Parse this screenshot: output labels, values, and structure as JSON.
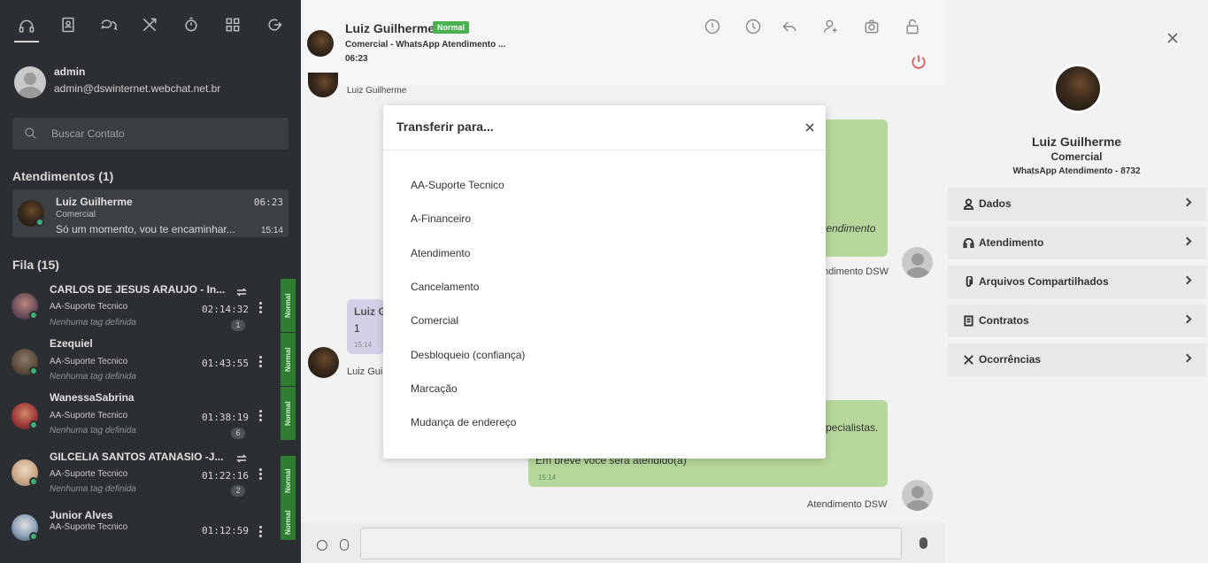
{
  "sidebar": {
    "nav_icons": [
      "headset-icon",
      "contacts-book-icon",
      "chat-bubbles-icon",
      "tools-icon",
      "timer-icon",
      "grid-icon",
      "logout-icon"
    ],
    "profile": {
      "name": "admin",
      "email": "admin@dswinternet.webchat.net.br"
    },
    "search": {
      "placeholder": "Buscar Contato"
    },
    "active_section": "Atendimentos (1)",
    "active_chat": {
      "name": "Luiz Guilherme",
      "dept": "Comercial",
      "message": "Só um momento, vou te encaminhar...",
      "time": "06:23",
      "last": "15:14"
    },
    "queue_section": "Fila (15)",
    "queue": [
      {
        "name": "CARLOS DE JESUS ARAUJO - In...",
        "dept": "AA-Suporte Tecnico",
        "tag": "Nenhuma tag definida",
        "time": "02:14:32",
        "count": "1",
        "badge": "Normal"
      },
      {
        "name": "Ezequiel",
        "dept": "AA-Suporte Tecnico",
        "tag": "Nenhuma tag definida",
        "time": "01:43:55",
        "count": "",
        "badge": "Normal"
      },
      {
        "name": "WanessaSabrina",
        "dept": "AA-Suporte Tecnico",
        "tag": "Nenhuma tag definida",
        "time": "01:38:19",
        "count": "6",
        "badge": "Normal"
      },
      {
        "name": "GILCELIA SANTOS ATANASIO -J...",
        "dept": "AA-Suporte Tecnico",
        "tag": "Nenhuma tag definida",
        "time": "01:22:16",
        "count": "2",
        "badge": "Normal"
      },
      {
        "name": "Junior Alves",
        "dept": "AA-Suporte Tecnico",
        "tag": "",
        "time": "01:12:59",
        "count": "",
        "badge": "Normal"
      }
    ]
  },
  "chat": {
    "header": {
      "name": "Luiz Guilherme",
      "status": "Normal",
      "sub": "Comercial - WhatsApp Atendimento ...",
      "time": "06:23"
    },
    "header_icons": [
      "alert-icon",
      "clock-icon",
      "reply-icon",
      "transfer-user-icon",
      "camera-icon",
      "unlock-icon"
    ],
    "messages": {
      "top_sender": "Luiz Guilherme",
      "agent_italic": "tendimento",
      "agent_sender1": "ndimento DSW",
      "user_bubble_name": "Luiz G",
      "user_bubble_text": "1",
      "user_bubble_time": "15:14",
      "user_sender": "Luiz Gui",
      "agent2_line1": "pecialistas.",
      "agent2_line2": "Em breve você será atendido(a)",
      "agent2_time": "15:14",
      "agent_sender2": "Atendimento DSW"
    }
  },
  "right_panel": {
    "name": "Luiz Guilherme",
    "dept": "Comercial",
    "channel": "WhatsApp Atendimento - 8732",
    "items": [
      "Dados",
      "Atendimento",
      "Arquivos Compartilhados",
      "Contratos",
      "Ocorrências"
    ]
  },
  "modal": {
    "title": "Transferir para...",
    "options": [
      "AA-Suporte Tecnico",
      "A-Financeiro",
      "Atendimento",
      "Cancelamento",
      "Comercial",
      "Desbloqueio (confiança)",
      "Marcação",
      "Mudança de endereço"
    ]
  }
}
